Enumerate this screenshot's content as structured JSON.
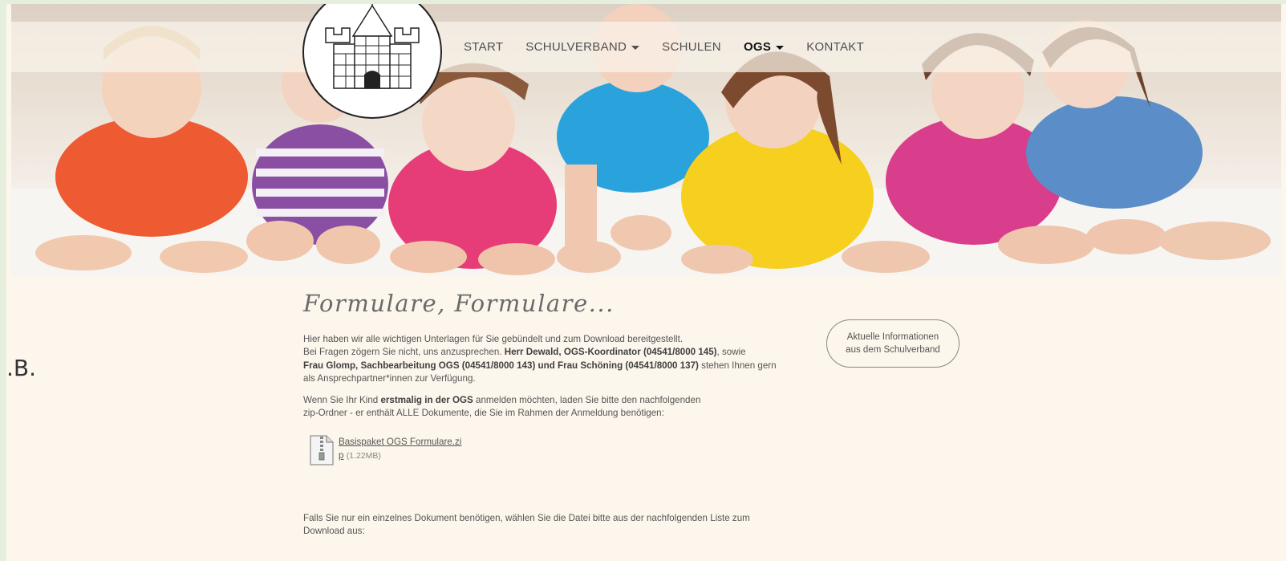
{
  "nav": {
    "items": [
      {
        "label": "START",
        "dropdown": false,
        "active": false
      },
      {
        "label": "SCHULVERBAND",
        "dropdown": true,
        "active": false
      },
      {
        "label": "SCHULEN",
        "dropdown": false,
        "active": false
      },
      {
        "label": "OGS",
        "dropdown": true,
        "active": true
      },
      {
        "label": "KONTAKT",
        "dropdown": false,
        "active": false
      }
    ]
  },
  "side_text": ".B.",
  "main": {
    "title": "Formulare, Formulare...",
    "intro_line1": "Hier haben wir alle wichtigen Unterlagen für Sie gebündelt und zum Download bereitgestellt.",
    "intro_line2_a": "Bei Fragen zögern Sie nicht, uns anzusprechen. ",
    "intro_line2_b": "Herr Dewald, OGS-Koordinator (04541/8000 145)",
    "intro_line2_c": ", sowie",
    "intro_line3_b": "Frau Glomp, Sachbearbeitung OGS (04541/8000 143) und Frau Schöning (04541/8000 137)",
    "intro_line3_c": "  stehen Ihnen gern",
    "intro_line4": "als Ansprechpartner*innen zur Verfügung.",
    "first_a": "Wenn Sie Ihr Kind ",
    "first_b": "erstmalig in der OGS",
    "first_c": " anmelden möchten, laden Sie bitte den nachfolgenden",
    "first_line2": "zip-Ordner - er enthält ALLE Dokumente, die Sie im Rahmen der Anmeldung benötigen:",
    "download": {
      "name_line1": "Basispaket OGS Formulare.zi",
      "name_line2": "p",
      "size": "(1.22MB)"
    },
    "single_line1": "Falls Sie nur ein einzelnes Dokument benötigen, wählen Sie die Datei bitte aus der nachfolgenden Liste zum",
    "single_line2": "Download aus:"
  },
  "info_button": {
    "line1": "Aktuelle Informationen",
    "line2": "aus dem Schulverband"
  },
  "colors": {
    "page_bg": "#fcf6ec",
    "outer_bg": "#e6eedd",
    "nav_active": "#111111",
    "nav_text": "#4f4f4f"
  },
  "icons": {
    "download_file": "zip-file-icon",
    "logo": "castle-crest-logo"
  }
}
